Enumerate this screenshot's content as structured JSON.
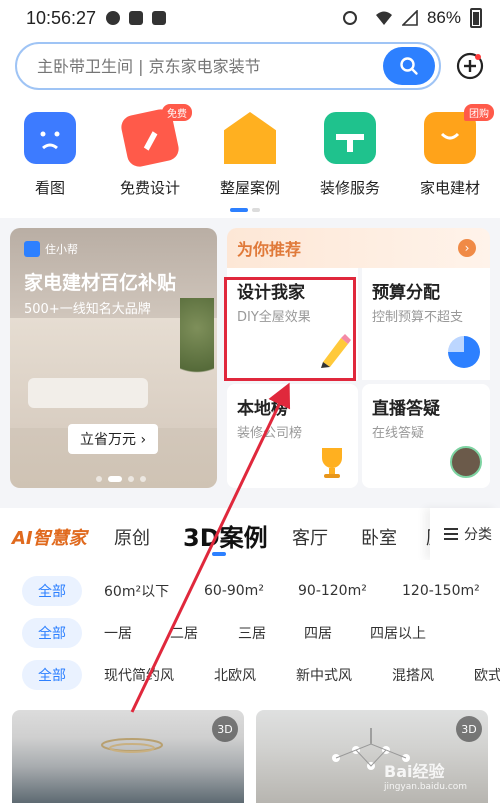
{
  "status_bar": {
    "time": "10:56:27",
    "battery": "86%"
  },
  "search": {
    "placeholder": "主卧带卫生间 | 京东家电家装节"
  },
  "categories": [
    {
      "label": "看图",
      "icon": "sad-face-icon",
      "color": "#3d7bff"
    },
    {
      "label": "免费设计",
      "icon": "pencil-icon",
      "color": "#ff5a4a",
      "tag": "免费"
    },
    {
      "label": "整屋案例",
      "icon": "house-icon",
      "color": "#ffb020"
    },
    {
      "label": "装修服务",
      "icon": "toolbox-icon",
      "color": "#1fc28d"
    },
    {
      "label": "家电建材",
      "icon": "bag-icon",
      "color": "#ffa31a",
      "tag": "团购"
    }
  ],
  "banner": {
    "brand": "住小帮",
    "title": "家电建材百亿补贴",
    "subtitle": "500+一线知名大品牌",
    "cta": "立省万元 ›"
  },
  "recommend": {
    "title": "为你推荐",
    "cards": [
      {
        "title": "设计我家",
        "subtitle": "DIY全屋效果"
      },
      {
        "title": "预算分配",
        "subtitle": "控制预算不超支"
      },
      {
        "title": "本地榜",
        "subtitle": "装修公司榜"
      },
      {
        "title": "直播答疑",
        "subtitle": "在线答疑"
      }
    ]
  },
  "tabs": {
    "items": [
      "AI智慧家",
      "原创",
      "3D案例",
      "客厅",
      "卧室",
      "厨"
    ],
    "active": "3D案例",
    "more": "分类"
  },
  "filters": {
    "area": [
      "全部",
      "60m²以下",
      "60-90m²",
      "90-120m²",
      "120-150m²"
    ],
    "rooms": [
      "全部",
      "一居",
      "二居",
      "三居",
      "四居",
      "四居以上"
    ],
    "style": [
      "全部",
      "现代简约风",
      "北欧风",
      "新中式风",
      "混搭风",
      "欧式"
    ]
  },
  "photos": [
    {
      "badge": "3D"
    },
    {
      "badge": "3D"
    }
  ],
  "watermark": {
    "text": "Bai经验",
    "sub": "jingyan.baidu.com"
  }
}
